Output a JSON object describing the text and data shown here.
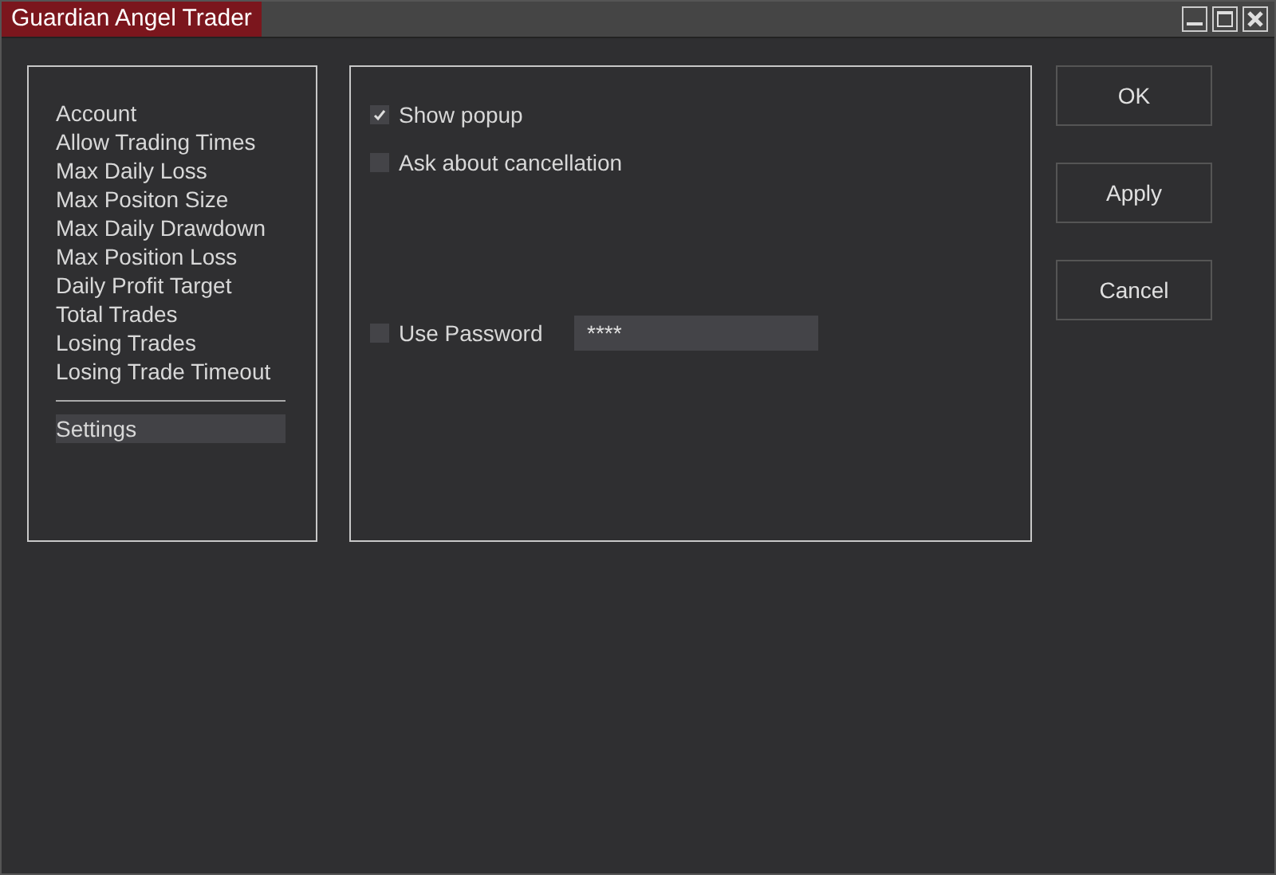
{
  "window": {
    "title": "Guardian Angel Trader"
  },
  "sidebar": {
    "groups": [
      {
        "items": [
          {
            "label": "Account",
            "selected": false
          },
          {
            "label": "Allow Trading Times",
            "selected": false
          },
          {
            "label": "Max Daily Loss",
            "selected": false
          },
          {
            "label": "Max Positon Size",
            "selected": false
          },
          {
            "label": "Max Daily Drawdown",
            "selected": false
          },
          {
            "label": "Max Position Loss",
            "selected": false
          },
          {
            "label": "Daily Profit Target",
            "selected": false
          },
          {
            "label": "Total Trades",
            "selected": false
          },
          {
            "label": "Losing Trades",
            "selected": false
          },
          {
            "label": "Losing Trade Timeout",
            "selected": false
          }
        ]
      },
      {
        "items": [
          {
            "label": "Settings",
            "selected": true
          }
        ]
      }
    ]
  },
  "options": [
    {
      "kind": "checkbox",
      "label": "Show popup",
      "checked": true
    },
    {
      "kind": "checkbox",
      "label": "Ask about cancellation",
      "checked": false
    },
    {
      "kind": "password",
      "label": "Use Password",
      "checked": false,
      "value": "****"
    }
  ],
  "buttons": [
    "OK",
    "Apply",
    "Cancel"
  ]
}
